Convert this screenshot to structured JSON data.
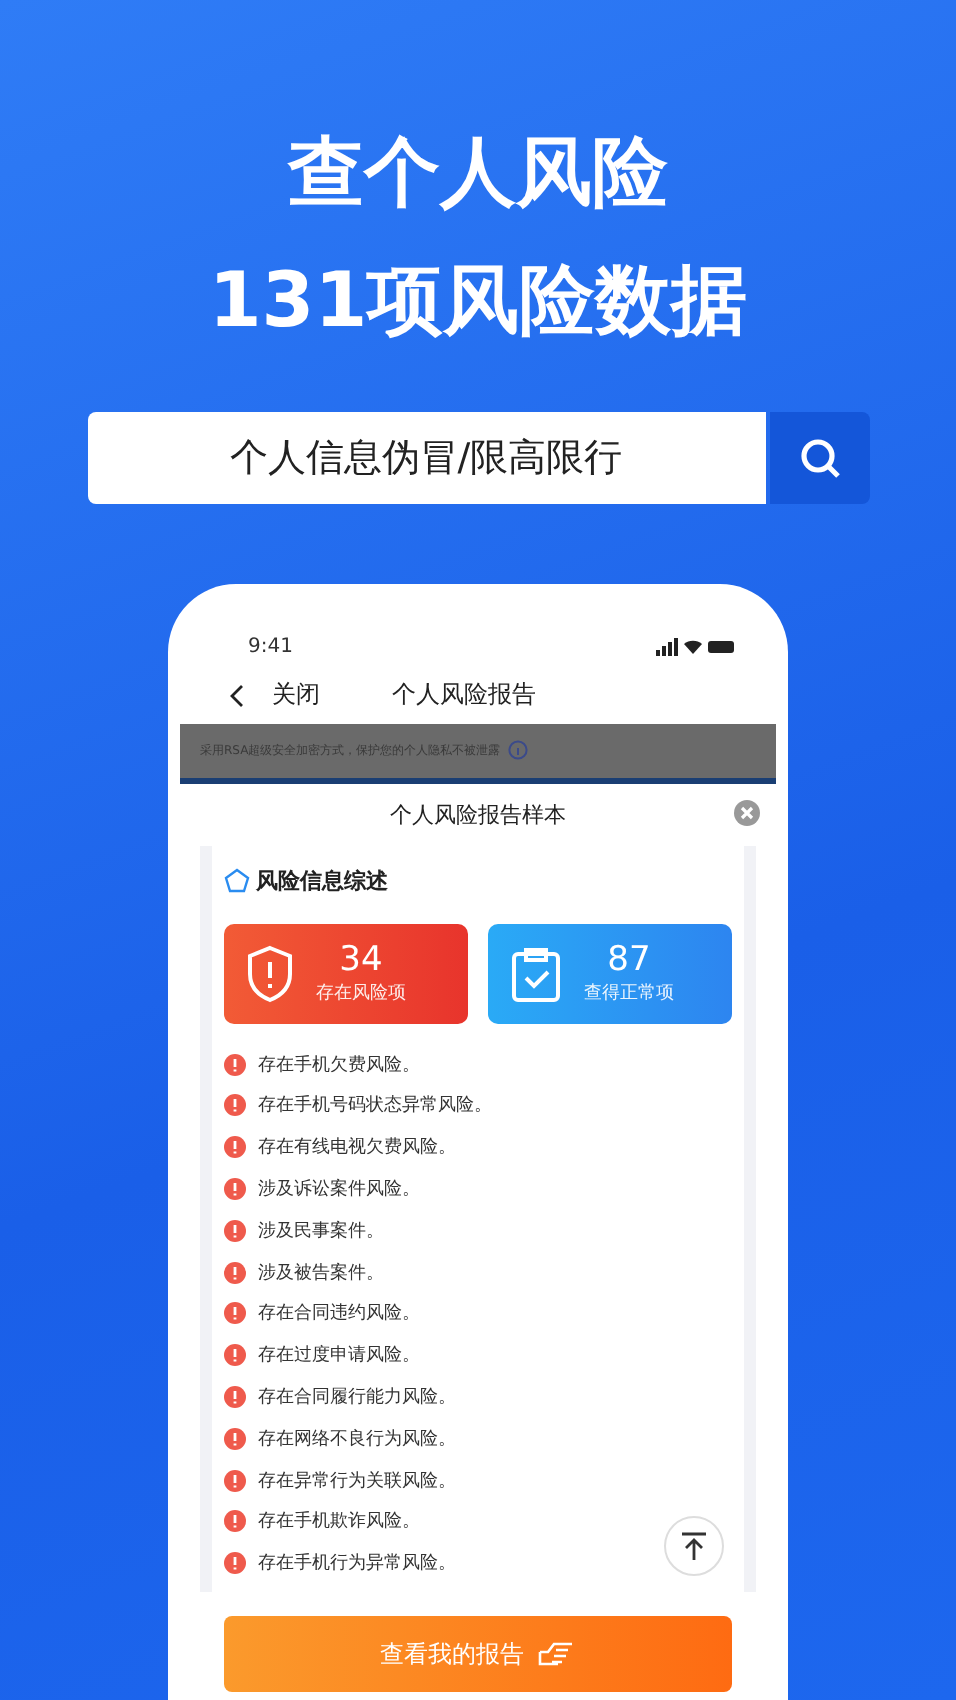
{
  "headline": [
    "查个人风险",
    "131项风险数据"
  ],
  "search": {
    "value": "个人信息伪冒/限高限行"
  },
  "phone": {
    "time": "9:41",
    "back": "关闭",
    "title": "个人风险报告",
    "banner": "采用RSA超级安全加密方式，保护您的个人隐私不被泄露",
    "sheet": {
      "title": "个人风险报告样本",
      "section": "风险信息综述",
      "stats": [
        {
          "kind": "risk",
          "value": "34",
          "label": "存在风险项"
        },
        {
          "kind": "ok",
          "value": "87",
          "label": "查得正常项"
        }
      ],
      "items": [
        "存在手机欠费风险。",
        "存在手机号码状态异常风险。",
        "存在有线电视欠费风险。",
        "涉及诉讼案件风险。",
        "涉及民事案件。",
        "涉及被告案件。",
        "存在合同违约风险。",
        "存在过度申请风险。",
        "存在合同履行能力风险。",
        "存在网络不良行为风险。",
        "存在异常行为关联风险。",
        "存在手机欺诈风险。",
        "存在手机行为异常风险。"
      ],
      "button": "查看我的报告"
    }
  }
}
